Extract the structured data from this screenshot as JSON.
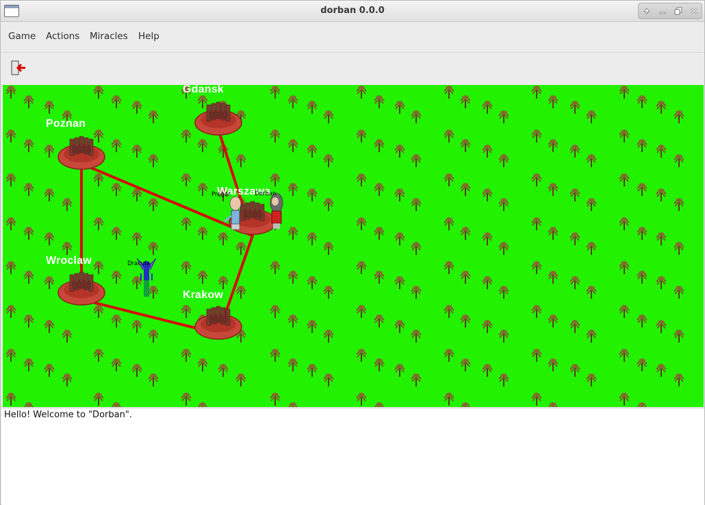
{
  "window": {
    "title": "dorban 0.0.0"
  },
  "menu": {
    "items": [
      "Game",
      "Actions",
      "Miracles",
      "Help"
    ]
  },
  "toolbar": {
    "exit_icon": "exit-door-icon"
  },
  "map": {
    "background_color": "#22f200",
    "road_color": "#d40b0b",
    "cities": [
      {
        "name": "Gdansk"
      },
      {
        "name": "Poznan"
      },
      {
        "name": "Warszawa"
      },
      {
        "name": "Wroclaw"
      },
      {
        "name": "Krakow"
      }
    ],
    "characters": [
      {
        "name": "Pregor"
      },
      {
        "name": "Dorban"
      },
      {
        "name": "Dracula"
      }
    ]
  },
  "log": {
    "lines": [
      "Hello! Welcome to \"Dorban\"."
    ]
  }
}
